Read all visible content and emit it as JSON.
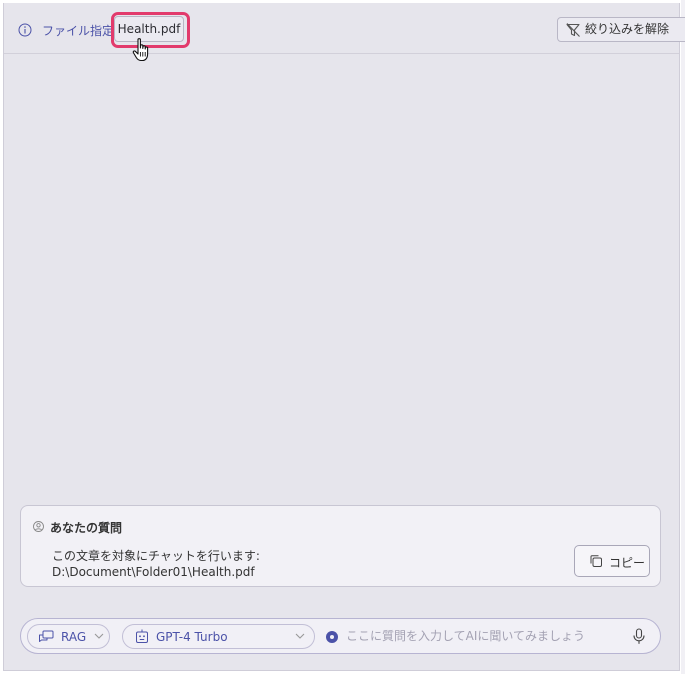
{
  "header": {
    "file_label": "ファイル指定",
    "file_chip": "Health.pdf",
    "filter_clear_label": "絞り込みを解除"
  },
  "question_card": {
    "title": "あなたの質問",
    "line1": "この文章を対象にチャットを行います:",
    "line2": "D:\\Document\\Folder01\\Health.pdf",
    "copy_label": "コピー"
  },
  "input_bar": {
    "mode_label": "RAG",
    "model_label": "GPT-4 Turbo",
    "placeholder": "ここに質問を入力してAIに聞いてみましょう"
  },
  "colors": {
    "accent": "#4b52a8",
    "highlight_ring": "#e23a6c",
    "panel_bg": "#e6e5ec"
  }
}
